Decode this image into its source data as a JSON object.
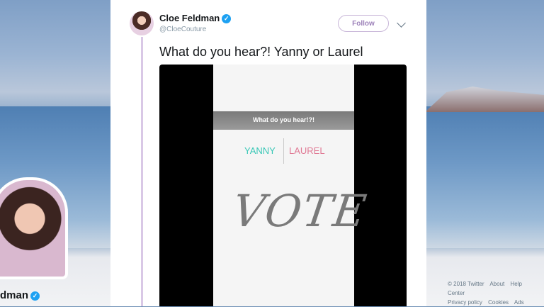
{
  "tweet": {
    "author_name": "Cloe Feldman",
    "handle": "@CloeCouture",
    "verified_icon": "✓",
    "follow_label": "Follow",
    "text": "What do you hear?! Yanny or Laurel"
  },
  "video": {
    "banner": "What do you hear!?!",
    "option_left": "YANNY",
    "option_right": "LAUREL",
    "vote": "VOTE"
  },
  "profile": {
    "name_partial": "dman"
  },
  "footer": {
    "line1": [
      "© 2018 Twitter",
      "About",
      "Help Center"
    ],
    "line2": [
      "Privacy policy",
      "Cookies",
      "Ads"
    ]
  },
  "icons": {
    "more": "chevron-down-icon",
    "verified": "verified-icon"
  }
}
